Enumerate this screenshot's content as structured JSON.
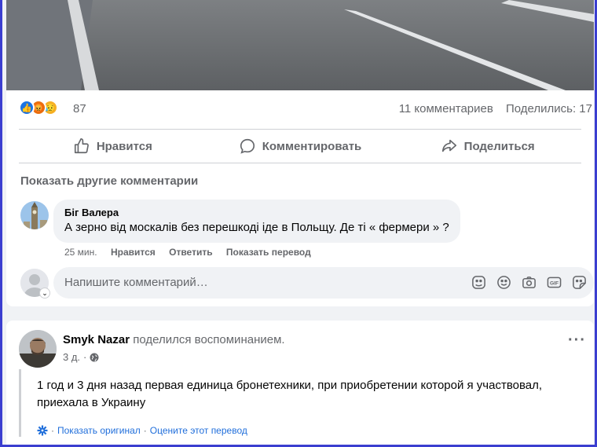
{
  "post1": {
    "reactions": {
      "count": "87",
      "icons": [
        "like-icon",
        "angry-icon",
        "sad-icon"
      ]
    },
    "comments_count": "11 комментариев",
    "shares_count": "Поделились: 17",
    "actions": {
      "like": "Нравится",
      "comment": "Комментировать",
      "share": "Поделиться"
    },
    "more_comments": "Показать другие комментарии",
    "comment": {
      "author": "Біг Валера",
      "text": "А зерно від москалів без перешкоді іде в Польщу. Де ті « фермери » ?",
      "time": "25 мин.",
      "like": "Нравится",
      "reply": "Ответить",
      "translate": "Показать перевод"
    },
    "composer": {
      "placeholder": "Напишите комментарий…",
      "icons": [
        "avatar-sticker-icon",
        "emoji-icon",
        "camera-icon",
        "gif-icon",
        "sticker-icon"
      ]
    }
  },
  "post2": {
    "author": "Smyk Nazar",
    "action": "поделился воспоминанием.",
    "time": "3 д.",
    "privacy_icon": "globe-icon",
    "text": "1 год и 3 дня назад первая единица бронетехники, при приобретении которой я участвовал, приехала в Украину",
    "show_original": "Показать оригинал",
    "rate_translation": "Оцените этот перевод",
    "separator": "·"
  },
  "colors": {
    "frame": "#3b3ed0",
    "link": "#216fdb",
    "secondary_text": "#65676b",
    "like_blue": "#1b74e4"
  }
}
